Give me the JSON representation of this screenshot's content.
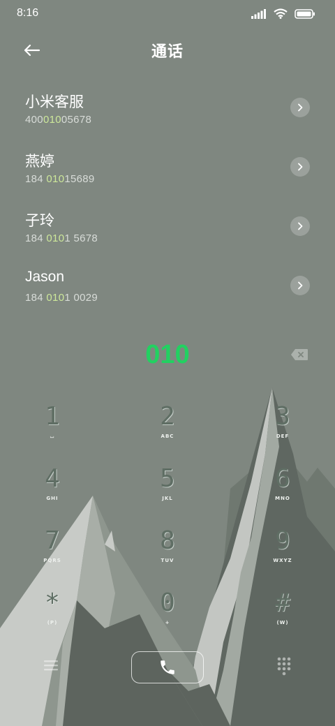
{
  "status": {
    "time": "8:16"
  },
  "header": {
    "title": "通话"
  },
  "contacts": [
    {
      "name": "小米客服",
      "num_pre": "400",
      "num_hl": "010",
      "num_post": "05678"
    },
    {
      "name": "燕婷",
      "num_pre": "184 ",
      "num_hl": "010",
      "num_post": "15689"
    },
    {
      "name": "子玲",
      "num_pre": "184 ",
      "num_hl": "010",
      "num_post": "1 5678"
    },
    {
      "name": "Jason",
      "num_pre": "184 ",
      "num_hl": "010",
      "num_post": "1 0029"
    }
  ],
  "dialer": {
    "input": "010"
  },
  "keypad": [
    {
      "digit": "1",
      "letters": "⌴"
    },
    {
      "digit": "2",
      "letters": "ABC"
    },
    {
      "digit": "3",
      "letters": "DEF"
    },
    {
      "digit": "4",
      "letters": "GHI"
    },
    {
      "digit": "5",
      "letters": "JKL"
    },
    {
      "digit": "6",
      "letters": "MNO"
    },
    {
      "digit": "7",
      "letters": "PQRS"
    },
    {
      "digit": "8",
      "letters": "TUV"
    },
    {
      "digit": "9",
      "letters": "WXYZ"
    },
    {
      "digit": "*",
      "letters": "(P)"
    },
    {
      "digit": "0",
      "letters": "+"
    },
    {
      "digit": "#",
      "letters": "(W)"
    }
  ],
  "icons": {
    "back": "arrow-left-icon",
    "chevron": "chevron-right-icon",
    "backspace": "backspace-icon",
    "menu": "menu-icon",
    "call": "phone-icon",
    "keypad": "dialpad-icon"
  },
  "colors": {
    "accent": "#22d161",
    "highlight": "#cde89a",
    "background": "#7f8780"
  }
}
